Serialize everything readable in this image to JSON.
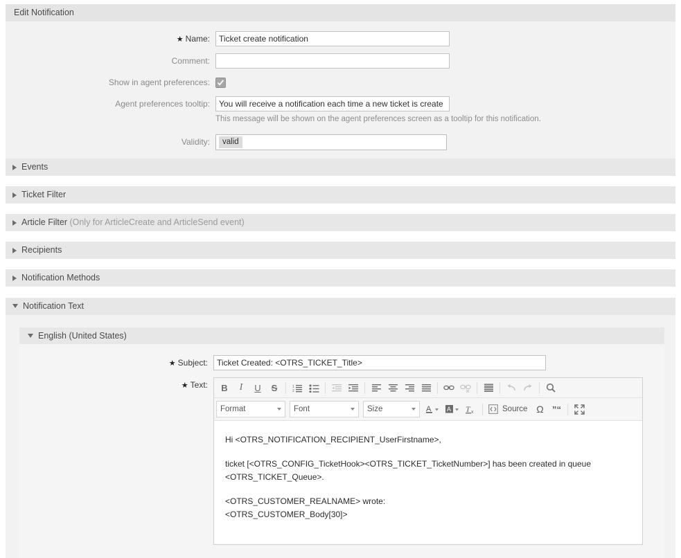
{
  "widget": {
    "title": "Edit Notification",
    "fields": {
      "name": {
        "label": "Name:",
        "value": "Ticket create notification",
        "required": true
      },
      "comment": {
        "label": "Comment:",
        "value": "",
        "placeholder": ""
      },
      "show_in_agent_prefs": {
        "label": "Show in agent preferences:",
        "checked": true
      },
      "agent_prefs_tooltip": {
        "label": "Agent preferences tooltip:",
        "value": "You will receive a notification each time a new ticket is create",
        "help": "This message will be shown on the agent preferences screen as a tooltip for this notification."
      },
      "validity": {
        "label": "Validity:",
        "selected": "valid"
      }
    }
  },
  "sections": [
    {
      "label": "Events",
      "note": "",
      "expanded": false
    },
    {
      "label": "Ticket Filter",
      "note": "",
      "expanded": false
    },
    {
      "label": "Article Filter",
      "note": "(Only for ArticleCreate and ArticleSend event)",
      "expanded": false
    },
    {
      "label": "Recipients",
      "note": "",
      "expanded": false
    },
    {
      "label": "Notification Methods",
      "note": "",
      "expanded": false
    }
  ],
  "notification_text": {
    "title": "Notification Text",
    "language": {
      "title": "English (United States)",
      "subject": {
        "label": "Subject:",
        "value": "Ticket Created: <OTRS_TICKET_Title>"
      },
      "text": {
        "label": "Text:"
      }
    }
  },
  "editor": {
    "toolbar_row1": [
      {
        "name": "bold-icon",
        "glyph": "B",
        "dim": false
      },
      {
        "name": "italic-icon",
        "glyph": "I",
        "dim": false
      },
      {
        "name": "underline-icon",
        "glyph": "U",
        "dim": false
      },
      {
        "name": "strikethrough-icon",
        "glyph": "S",
        "dim": false
      },
      {
        "name": "separator",
        "glyph": "",
        "dim": false
      },
      {
        "name": "numbered-list-icon",
        "glyph": "",
        "dim": false
      },
      {
        "name": "bulleted-list-icon",
        "glyph": "",
        "dim": false
      },
      {
        "name": "separator",
        "glyph": "",
        "dim": false
      },
      {
        "name": "outdent-icon",
        "glyph": "",
        "dim": true
      },
      {
        "name": "indent-icon",
        "glyph": "",
        "dim": false
      },
      {
        "name": "separator",
        "glyph": "",
        "dim": false
      },
      {
        "name": "align-left-icon",
        "glyph": "",
        "dim": false
      },
      {
        "name": "align-center-icon",
        "glyph": "",
        "dim": false
      },
      {
        "name": "align-right-icon",
        "glyph": "",
        "dim": false
      },
      {
        "name": "align-justify-icon",
        "glyph": "",
        "dim": false
      },
      {
        "name": "separator",
        "glyph": "",
        "dim": false
      },
      {
        "name": "link-icon",
        "glyph": "",
        "dim": false
      },
      {
        "name": "unlink-icon",
        "glyph": "",
        "dim": true
      },
      {
        "name": "separator",
        "glyph": "",
        "dim": false
      },
      {
        "name": "blockquote-icon",
        "glyph": "",
        "dim": false
      },
      {
        "name": "separator",
        "glyph": "",
        "dim": false
      },
      {
        "name": "undo-icon",
        "glyph": "",
        "dim": true
      },
      {
        "name": "redo-icon",
        "glyph": "",
        "dim": true
      },
      {
        "name": "separator",
        "glyph": "",
        "dim": false
      },
      {
        "name": "find-icon",
        "glyph": "",
        "dim": false
      }
    ],
    "combos": [
      {
        "name": "format-select",
        "label": "Format"
      },
      {
        "name": "font-select",
        "label": "Font"
      },
      {
        "name": "size-select",
        "label": "Size"
      }
    ],
    "source_label": "Source",
    "body_paragraphs": [
      "Hi <OTRS_NOTIFICATION_RECIPIENT_UserFirstname>,",
      "ticket [<OTRS_CONFIG_TicketHook><OTRS_TICKET_TicketNumber>] has been created in queue <OTRS_TICKET_Queue>.",
      "<OTRS_CUSTOMER_REALNAME> wrote:",
      "<OTRS_CUSTOMER_Body[30]>"
    ]
  },
  "colors": {
    "header_bar": "#e4e4e4",
    "section_bar": "#e7e7e7",
    "panel_bg": "#f2f2f2",
    "input_border": "#c2c2c2",
    "label_muted": "#8a8a8a",
    "text": "#444444"
  }
}
